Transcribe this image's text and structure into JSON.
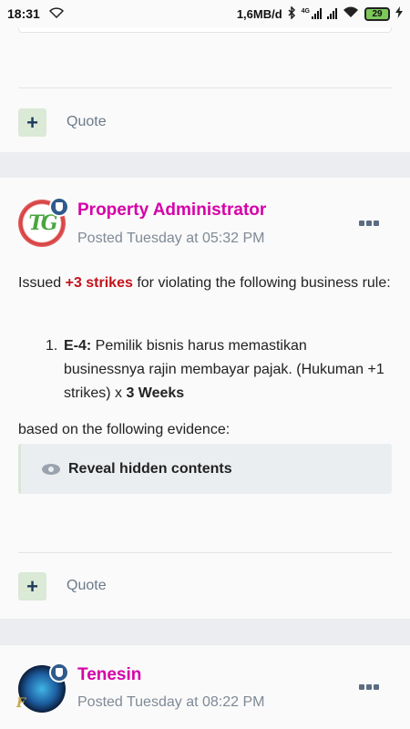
{
  "status_bar": {
    "time": "18:31",
    "network_speed": "1,6MB/d",
    "network_type": "4G",
    "battery": "29"
  },
  "top_card": {
    "quote_label": "Quote",
    "add_symbol": "+"
  },
  "post1": {
    "username": "Property Administrator",
    "posted": "Posted Tuesday at 05:32 PM",
    "avatar_text": "TG",
    "intro_before": "Issued ",
    "strikes": "+3 strikes",
    "intro_after": " for violating the following business rule:",
    "rule_number": "1.",
    "rule_code": "E-4:",
    "rule_text": " Pemilik bisnis harus memastikan businessnya rajin membayar pajak. (Hukuman +1 strikes) x ",
    "rule_duration": "3 Weeks",
    "evidence_text": "based on the following evidence:",
    "spoiler_label": "Reveal hidden contents",
    "quote_label": "Quote",
    "add_symbol": "+"
  },
  "post2": {
    "username": "Tenesin",
    "posted": "Posted Tuesday at 08:22 PM",
    "avatar_text": "F"
  },
  "colors": {
    "username": "#d600a8",
    "strikes": "#c3121b",
    "quote_button_bg": "#dbe9d7",
    "badge": "#2f5a8c"
  },
  "icons": [
    "wifi-icon",
    "bluetooth-icon",
    "signal-icon",
    "battery-icon",
    "moderator-shield-icon",
    "more-options-icon",
    "eye-icon",
    "plus-icon"
  ]
}
